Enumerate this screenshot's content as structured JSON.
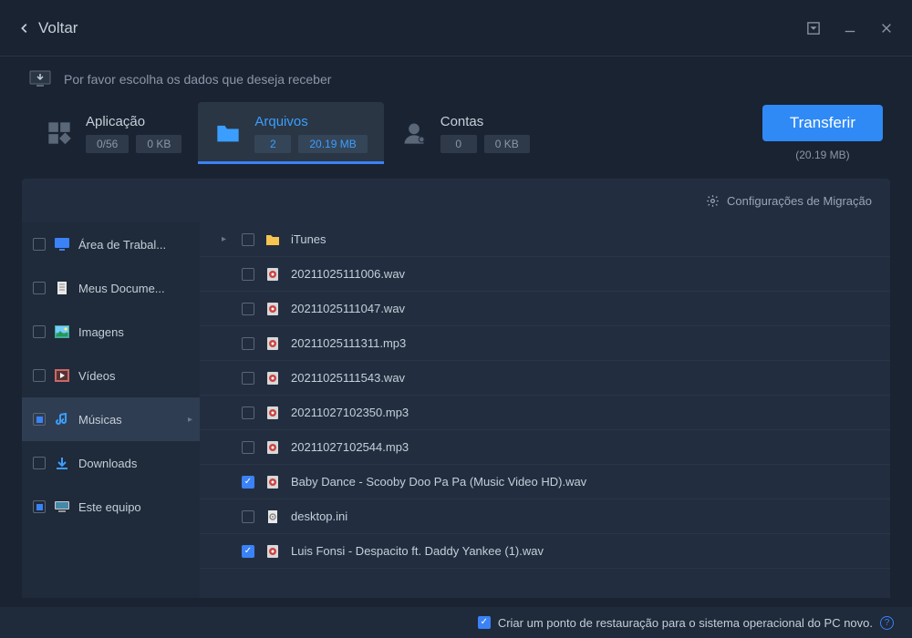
{
  "titlebar": {
    "back": "Voltar"
  },
  "instruction": "Por favor escolha os dados que deseja receber",
  "tabs": {
    "app": {
      "title": "Aplicação",
      "count": "0/56",
      "size": "0 KB"
    },
    "files": {
      "title": "Arquivos",
      "count": "2",
      "size": "20.19 MB"
    },
    "accounts": {
      "title": "Contas",
      "count": "0",
      "size": "0 KB"
    }
  },
  "transfer": {
    "button": "Transferir",
    "size": "(20.19 MB)"
  },
  "settings_link": "Configurações de Migração",
  "sidebar": [
    {
      "label": "Área de Trabal...",
      "icon": "desktop",
      "check": "none"
    },
    {
      "label": "Meus Docume...",
      "icon": "document",
      "check": "none"
    },
    {
      "label": "Imagens",
      "icon": "image",
      "check": "none"
    },
    {
      "label": "Vídeos",
      "icon": "video",
      "check": "none"
    },
    {
      "label": "Músicas",
      "icon": "music",
      "check": "partial",
      "selected": true
    },
    {
      "label": "Downloads",
      "icon": "download",
      "check": "none"
    },
    {
      "label": "Este equipo",
      "icon": "computer",
      "check": "partial"
    }
  ],
  "files": [
    {
      "name": "iTunes",
      "icon": "folder",
      "check": "none",
      "expandable": true
    },
    {
      "name": "20211025111006.wav",
      "icon": "audio",
      "check": "none"
    },
    {
      "name": "20211025111047.wav",
      "icon": "audio",
      "check": "none"
    },
    {
      "name": "20211025111311.mp3",
      "icon": "audio",
      "check": "none"
    },
    {
      "name": "20211025111543.wav",
      "icon": "audio",
      "check": "none"
    },
    {
      "name": "20211027102350.mp3",
      "icon": "audio",
      "check": "none"
    },
    {
      "name": "20211027102544.mp3",
      "icon": "audio",
      "check": "none"
    },
    {
      "name": "Baby Dance - Scooby Doo Pa Pa (Music Video HD).wav",
      "icon": "audio",
      "check": "checked"
    },
    {
      "name": "desktop.ini",
      "icon": "ini",
      "check": "none"
    },
    {
      "name": "Luis Fonsi - Despacito ft. Daddy Yankee (1).wav",
      "icon": "audio",
      "check": "checked"
    }
  ],
  "footer": {
    "restore_point": "Criar um ponto de restauração para o sistema operacional do PC novo."
  }
}
